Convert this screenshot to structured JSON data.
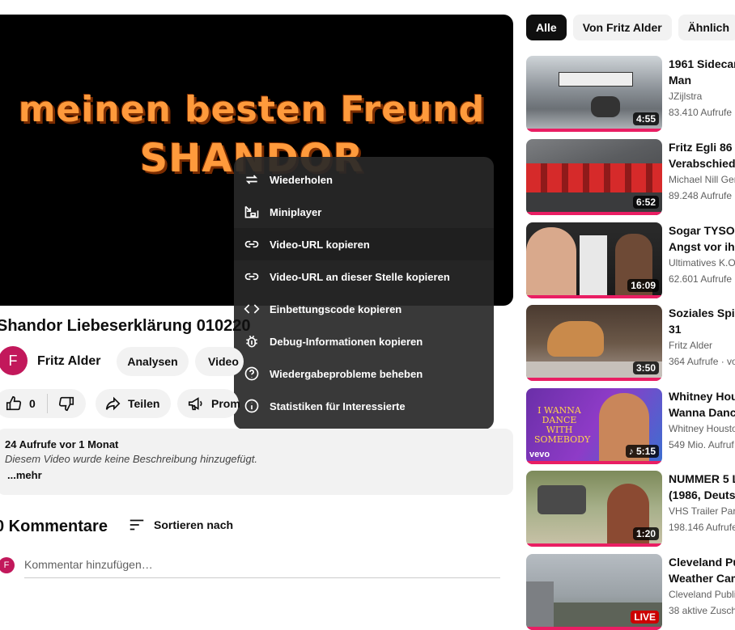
{
  "player": {
    "line1": "meinen besten Freund",
    "line2": "SHANDOR"
  },
  "context_menu": [
    {
      "label": "Wiederholen",
      "icon": "repeat-icon"
    },
    {
      "label": "Miniplayer",
      "icon": "miniplayer-icon"
    },
    {
      "label": "Video-URL kopieren",
      "icon": "link-icon",
      "highlighted": true
    },
    {
      "label": "Video-URL an dieser Stelle kopieren",
      "icon": "link-icon"
    },
    {
      "label": "Einbettungscode kopieren",
      "icon": "code-icon"
    },
    {
      "label": "Debug-Informationen kopieren",
      "icon": "bug-icon"
    },
    {
      "label": "Wiedergabeprobleme beheben",
      "icon": "help-icon"
    },
    {
      "label": "Statistiken für Interessierte",
      "icon": "info-icon"
    }
  ],
  "video": {
    "title": "Shandor Liebeserklärung 010220",
    "channel": "Fritz Alder",
    "avatar_letter": "F",
    "analytics_label": "Analysen",
    "video_label": "Video",
    "likes": "0",
    "share_label": "Teilen",
    "promote_label": "Prom"
  },
  "description": {
    "meta": "24 Aufrufe  vor 1 Monat",
    "text": "Diesem Video wurde keine Beschreibung hinzugefügt.",
    "more": "...mehr"
  },
  "comments": {
    "title": "0 Kommentare",
    "sort_label": "Sortieren nach",
    "avatar_letter": "F",
    "placeholder": "Kommentar hinzufügen…"
  },
  "chips": [
    "Alle",
    "Von Fritz Alder",
    "Ähnlich"
  ],
  "recommendations": [
    {
      "title1": "1961 Sidecar",
      "title2": "Man",
      "channel": "JZijlstra",
      "views": "83.410 Aufrufe",
      "duration": "4:55"
    },
    {
      "title1": "Fritz Egli  86 J",
      "title2": "Verabschiedu",
      "channel": "Michael Nill Ger",
      "views": "89.248 Aufrufe",
      "duration": "6:52"
    },
    {
      "title1": "Sogar TYSON",
      "title2": "Angst vor ihm",
      "channel": "Ultimatives K.O",
      "views": "62.601 Aufrufe",
      "duration": "16:09"
    },
    {
      "title1": "Soziales Spie",
      "title2": "31",
      "channel": "Fritz Alder",
      "views": "364 Aufrufe · vo",
      "duration": "3:50"
    },
    {
      "title1": "Whitney Hous",
      "title2": "Wanna Dance",
      "channel": "Whitney Housto",
      "views": "549 Mio. Aufruf",
      "duration": "5:15"
    },
    {
      "title1": "NUMMER 5 L",
      "title2": "(1986, Deutsc",
      "channel": "VHS Trailer Parl",
      "views": "198.146 Aufrufe",
      "duration": "1:20"
    },
    {
      "title1": "Cleveland Pu",
      "title2": "Weather Cam",
      "channel": "Cleveland Publi",
      "views": "38 aktive Zusch",
      "duration": "LIVE"
    }
  ]
}
